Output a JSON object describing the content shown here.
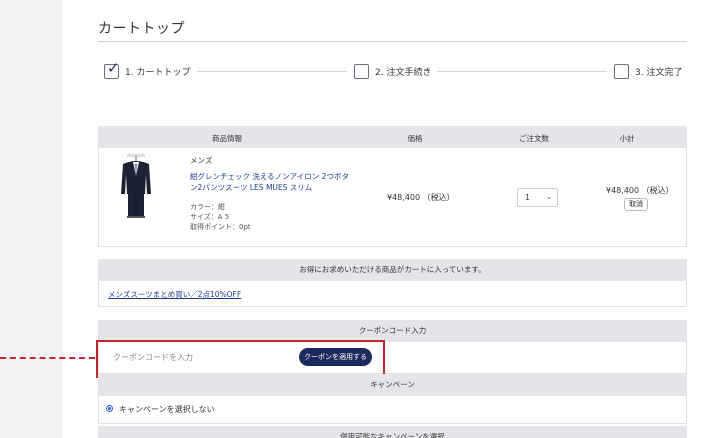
{
  "page": {
    "title": "カートトップ"
  },
  "steps": [
    {
      "label": "1. カートトップ",
      "checked": true
    },
    {
      "label": "2. 注文手続き",
      "checked": false
    },
    {
      "label": "3. 注文完了",
      "checked": false
    }
  ],
  "cart_table": {
    "headers": {
      "product": "商品情報",
      "price": "価格",
      "quantity": "ご注文数",
      "subtotal": "小計"
    },
    "item": {
      "category": "メンズ",
      "name": "紺グレンチェック 洗えるノンアイロン 2つボタン2パンツスーツ LES MUES スリム",
      "attr_color": "カラー：紺",
      "attr_size": "サイズ：A 5",
      "attr_points": "取得ポイント：0pt",
      "price": "¥48,400 （税込）",
      "quantity": "1",
      "subtotal": "¥48,400 （税込）",
      "cancel_label": "取消"
    }
  },
  "promo": {
    "header": "お得にお求めいただける商品がカートに入っています。",
    "link": "メンズスーツまとめ買い／2点10%OFF"
  },
  "coupon": {
    "header": "クーポンコード入力",
    "placeholder": "クーポンコードを入力",
    "apply_label": "クーポンを適用する"
  },
  "campaign": {
    "header": "キャンペーン",
    "option": "キャンペーンを選択しない",
    "available_header": "併用可能なキャンペーンを選択"
  },
  "colors": {
    "accent_navy": "#1a2a5e",
    "highlight_red": "#c0282d",
    "link_blue": "#1f3e8c"
  }
}
